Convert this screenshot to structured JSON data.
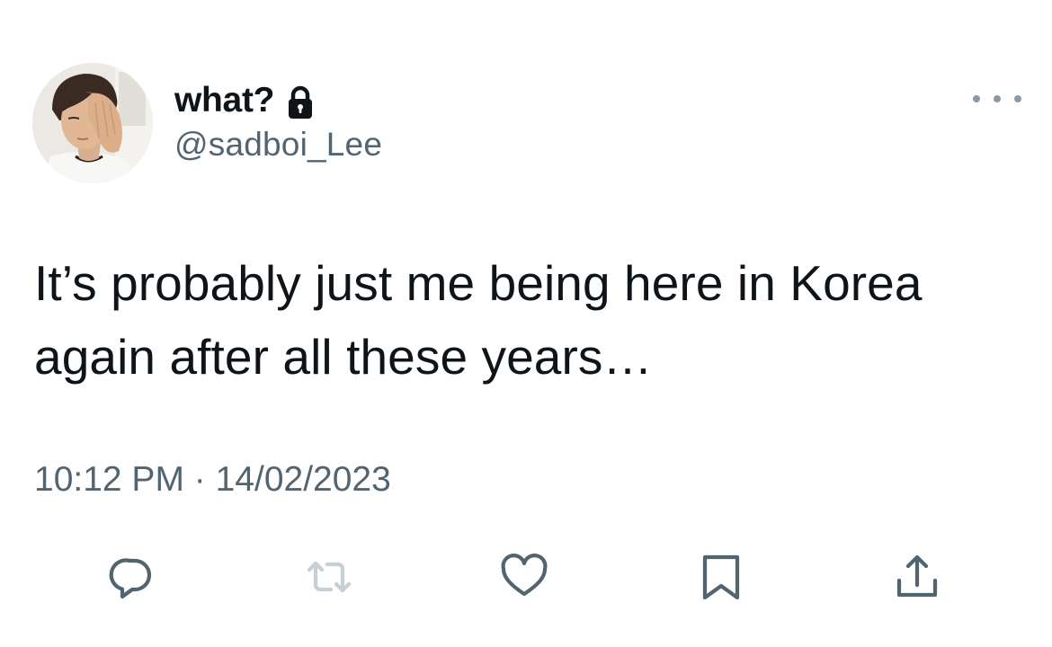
{
  "user": {
    "display_name": "what?",
    "handle": "@sadboi_Lee",
    "protected_icon": "lock-icon",
    "avatar_icon": "avatar"
  },
  "tweet": {
    "text": "It’s probably just me being here in Korea again after all these years…",
    "time": "10:12 PM",
    "separator": " · ",
    "date": "14/02/2023"
  },
  "actions": {
    "reply_icon": "reply-icon",
    "retweet_icon": "retweet-icon",
    "like_icon": "heart-icon",
    "bookmark_icon": "bookmark-icon",
    "share_icon": "share-icon",
    "more_icon": "more-dots-icon"
  },
  "colors": {
    "text_primary": "#0f1419",
    "text_secondary": "#536471",
    "icon": "#536471",
    "icon_disabled": "#c4cfd6",
    "more_dots": "#8b98a5"
  }
}
